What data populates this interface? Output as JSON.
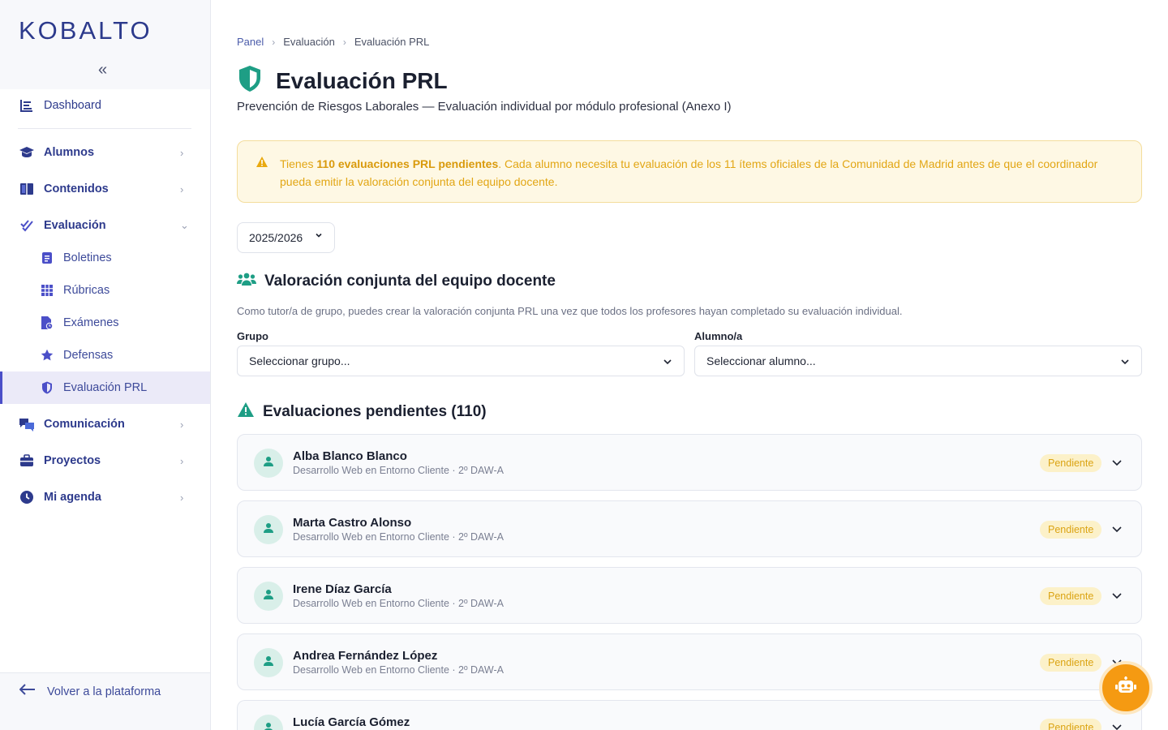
{
  "brand": {
    "logo_text": "KOBALTO",
    "collapse_icon": "«"
  },
  "sidebar": {
    "dashboard": "Dashboard",
    "items": [
      {
        "label": "Alumnos",
        "icon": "graduation-cap-icon"
      },
      {
        "label": "Contenidos",
        "icon": "book-icon"
      },
      {
        "label": "Evaluación",
        "icon": "check-double-icon",
        "expanded": true
      },
      {
        "label": "Comunicación",
        "icon": "comments-icon"
      },
      {
        "label": "Proyectos",
        "icon": "briefcase-icon"
      },
      {
        "label": "Mi agenda",
        "icon": "clock-icon"
      }
    ],
    "sub_items": [
      {
        "label": "Boletines",
        "icon": "clipboard-icon"
      },
      {
        "label": "Rúbricas",
        "icon": "grid-icon"
      },
      {
        "label": "Exámenes",
        "icon": "file-clock-icon"
      },
      {
        "label": "Defensas",
        "icon": "star-icon"
      },
      {
        "label": "Evaluación PRL",
        "icon": "shield-icon",
        "active": true
      }
    ],
    "back_label": "Volver a la plataforma"
  },
  "breadcrumb": [
    "Panel",
    "Evaluación",
    "Evaluación PRL"
  ],
  "page": {
    "title": "Evaluación PRL",
    "subtitle": "Prevención de Riesgos Laborales — Evaluación individual por módulo profesional (Anexo I)"
  },
  "alert": {
    "pre": "Tienes ",
    "bold": "110 evaluaciones PRL pendientes",
    "post": ". Cada alumno necesita tu evaluación de los 11 ítems oficiales de la Comunidad de Madrid antes de que el coordinador pueda emitir la valoración conjunta del equipo docente."
  },
  "year_select": {
    "value": "2025/2026"
  },
  "joint_section": {
    "title": "Valoración conjunta del equipo docente",
    "description": "Como tutor/a de grupo, puedes crear la valoración conjunta PRL una vez que todos los profesores hayan completado su evaluación individual.",
    "group_label": "Grupo",
    "group_value": "Seleccionar grupo...",
    "student_label": "Alumno/a",
    "student_value": "Seleccionar alumno..."
  },
  "pending_section": {
    "title": "Evaluaciones pendientes (110)"
  },
  "students": [
    {
      "name": "Alba Blanco Blanco",
      "meta": "Desarrollo Web en Entorno Cliente · 2º DAW-A",
      "status": "Pendiente"
    },
    {
      "name": "Marta Castro Alonso",
      "meta": "Desarrollo Web en Entorno Cliente · 2º DAW-A",
      "status": "Pendiente"
    },
    {
      "name": "Irene Díaz García",
      "meta": "Desarrollo Web en Entorno Cliente · 2º DAW-A",
      "status": "Pendiente"
    },
    {
      "name": "Andrea Fernández López",
      "meta": "Desarrollo Web en Entorno Cliente · 2º DAW-A",
      "status": "Pendiente"
    },
    {
      "name": "Lucía García Gómez",
      "meta": "",
      "status": "Pendiente"
    }
  ],
  "colors": {
    "primary": "#2d3a8c",
    "accent": "#4b4fc8",
    "teal": "#1e9e85",
    "warning": "#e2a614",
    "fab": "#f59a12"
  }
}
